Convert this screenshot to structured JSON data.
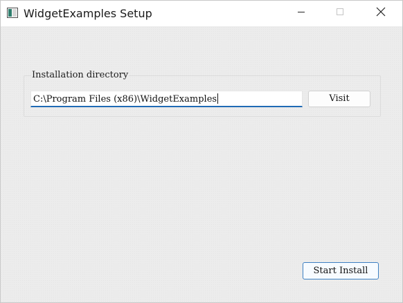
{
  "window": {
    "title": "WidgetExamples Setup",
    "icon": "app-window-icon",
    "controls": [
      "minimize-icon",
      "maximize-icon",
      "close-icon"
    ]
  },
  "install": {
    "group_title": "Installation directory",
    "path_value": "C:\\Program Files (x86)\\WidgetExamples",
    "visit_label": "Visit",
    "start_label": "Start Install"
  },
  "colors": {
    "accent": "#1f6ab5",
    "window_bg": "#ececec",
    "titlebar_bg": "#ffffff"
  }
}
